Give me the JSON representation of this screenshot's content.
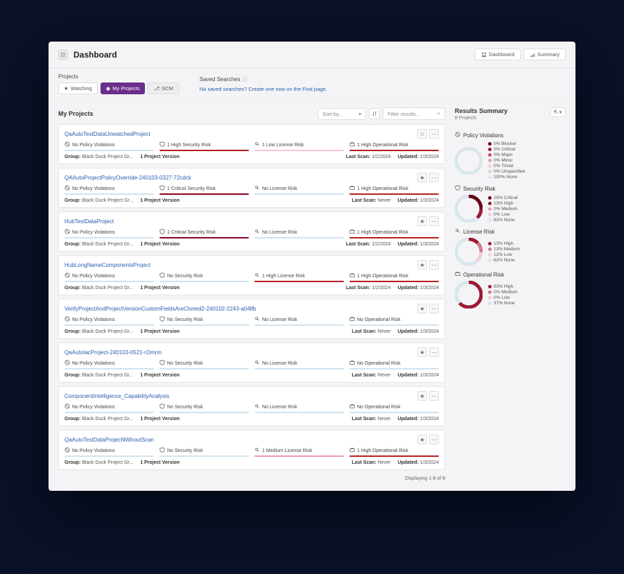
{
  "header": {
    "title": "Dashboard",
    "tab_dashboard": "Dashboard",
    "tab_summary": "Summary"
  },
  "filters": {
    "projects_label": "Projects",
    "watching": "Watching",
    "my_projects": "My Projects",
    "scm": "SCM",
    "saved_label": "Saved Searches",
    "saved_empty": "No saved searches? Create one now on the Find page."
  },
  "list": {
    "heading": "My Projects",
    "sort_placeholder": "Sort by...",
    "filter_placeholder": "Filter results...",
    "footer": "Displaying 1-8 of 8"
  },
  "projects": [
    {
      "name": "QaAutoTestDataUnwatchedProject",
      "policy": "No Policy Violations",
      "policy_bar": "none",
      "security": "1 High Security Risk",
      "security_bar": "high",
      "license": "1 Low License Risk",
      "license_bar": "low",
      "operational": "1 High Operational Risk",
      "operational_bar": "high",
      "group": "Black Duck Project Gr...",
      "versions": "1 Project Version",
      "last_scan": "1/2/2024",
      "updated": "1/3/2024",
      "star": "☆"
    },
    {
      "name": "QAAutoProjectPolicyOverride-240103-0327-72cdck",
      "policy": "No Policy Violations",
      "policy_bar": "none",
      "security": "1 Critical Security Risk",
      "security_bar": "crit",
      "license": "No License Risk",
      "license_bar": "none",
      "operational": "1 High Operational Risk",
      "operational_bar": "high",
      "group": "Black Duck Project Gr...",
      "versions": "1 Project Version",
      "last_scan": "Never",
      "updated": "1/3/2024",
      "star": "★"
    },
    {
      "name": "HubTestDataProject",
      "policy": "No Policy Violations",
      "policy_bar": "none",
      "security": "1 Critical Security Risk",
      "security_bar": "crit",
      "license": "No License Risk",
      "license_bar": "none",
      "operational": "1 High Operational Risk",
      "operational_bar": "high",
      "group": "Black Duck Project Gr...",
      "versions": "1 Project Version",
      "last_scan": "1/2/2024",
      "updated": "1/3/2024",
      "star": "★"
    },
    {
      "name": "HubLongNameComponentsProject",
      "policy": "No Policy Violations",
      "policy_bar": "none",
      "security": "No Security Risk",
      "security_bar": "none",
      "license": "1 High License Risk",
      "license_bar": "high",
      "operational": "1 High Operational Risk",
      "operational_bar": "high",
      "group": "Black Duck Project Gr...",
      "versions": "1 Project Version",
      "last_scan": "1/2/2024",
      "updated": "1/3/2024",
      "star": "★"
    },
    {
      "name": "VerifyProjectAndProjectVersionCustomFieldsAreCloned2-240102-2243-a04lfb",
      "policy": "No Policy Violations",
      "policy_bar": "none",
      "security": "No Security Risk",
      "security_bar": "none",
      "license": "No License Risk",
      "license_bar": "none",
      "operational": "No Operational Risk",
      "operational_bar": "none",
      "group": "Black Duck Project Gr...",
      "versions": "1 Project Version",
      "last_scan": "Never",
      "updated": "1/3/2024",
      "star": "★"
    },
    {
      "name": "QaAutoIacProject-240103-0521-r2imrm",
      "policy": "No Policy Violations",
      "policy_bar": "none",
      "security": "No Security Risk",
      "security_bar": "none",
      "license": "No License Risk",
      "license_bar": "none",
      "operational": "No Operational Risk",
      "operational_bar": "none",
      "group": "Black Duck Project Gr...",
      "versions": "1 Project Version",
      "last_scan": "Never",
      "updated": "1/3/2024",
      "star": "★"
    },
    {
      "name": "ComponentIntelligence_CapabilityAnalysis",
      "policy": "No Policy Violations",
      "policy_bar": "none",
      "security": "No Security Risk",
      "security_bar": "none",
      "license": "No License Risk",
      "license_bar": "none",
      "operational": "No Operational Risk",
      "operational_bar": "none",
      "group": "Black Duck Project Gr...",
      "versions": "1 Project Version",
      "last_scan": "Never",
      "updated": "1/3/2024",
      "star": "★"
    },
    {
      "name": "QaAutoTestDataProjectWithoutScan",
      "policy": "No Policy Violations",
      "policy_bar": "none",
      "security": "No Security Risk",
      "security_bar": "none",
      "license": "1 Medium License Risk",
      "license_bar": "med",
      "operational": "1 High Operational Risk",
      "operational_bar": "high",
      "group": "Black Duck Project Gr...",
      "versions": "1 Project Version",
      "last_scan": "Never",
      "updated": "1/3/2024",
      "star": "★"
    }
  ],
  "summary": {
    "title": "Results Summary",
    "count": "8 Projects",
    "sections": {
      "policy": {
        "title": "Policy Violations",
        "items": [
          {
            "label": "0% Blocker",
            "color": "#6b0014"
          },
          {
            "label": "0% Critical",
            "color": "#9e1b32"
          },
          {
            "label": "0% Major",
            "color": "#c0506a"
          },
          {
            "label": "0% Minor",
            "color": "#e3a5b3"
          },
          {
            "label": "0% Trivial",
            "color": "#efd0d6"
          },
          {
            "label": "0% Unspecified",
            "color": "#d6d6d6"
          },
          {
            "label": "100% None",
            "color": "#d9e6ee"
          }
        ],
        "donut": [
          {
            "c": "#d9e6ee",
            "v": 100
          }
        ]
      },
      "security": {
        "title": "Security Risk",
        "items": [
          {
            "label": "25% Critical",
            "color": "#6b0014"
          },
          {
            "label": "13% High",
            "color": "#9e1b32"
          },
          {
            "label": "0% Medium",
            "color": "#e3a5b3"
          },
          {
            "label": "0% Low",
            "color": "#efd0d6"
          },
          {
            "label": "62% None",
            "color": "#d9e6ee"
          }
        ],
        "donut": [
          {
            "c": "#6b0014",
            "v": 25
          },
          {
            "c": "#9e1b32",
            "v": 13
          },
          {
            "c": "#d9e6ee",
            "v": 62
          }
        ]
      },
      "license": {
        "title": "License Risk",
        "items": [
          {
            "label": "13% High",
            "color": "#9e1b32"
          },
          {
            "label": "13% Medium",
            "color": "#d17a88"
          },
          {
            "label": "12% Low",
            "color": "#efd0d6"
          },
          {
            "label": "62% None",
            "color": "#d9e6ee"
          }
        ],
        "donut": [
          {
            "c": "#9e1b32",
            "v": 13
          },
          {
            "c": "#d17a88",
            "v": 13
          },
          {
            "c": "#efd0d6",
            "v": 12
          },
          {
            "c": "#d9e6ee",
            "v": 62
          }
        ]
      },
      "operational": {
        "title": "Operational Risk",
        "items": [
          {
            "label": "63% High",
            "color": "#9e1b32"
          },
          {
            "label": "0% Medium",
            "color": "#d17a88"
          },
          {
            "label": "0% Low",
            "color": "#efd0d6"
          },
          {
            "label": "37% None",
            "color": "#d9e6ee"
          }
        ],
        "donut": [
          {
            "c": "#9e1b32",
            "v": 63
          },
          {
            "c": "#d9e6ee",
            "v": 37
          }
        ]
      }
    }
  },
  "labels": {
    "group": "Group:",
    "last_scan": "Last Scan:",
    "updated": "Updated:"
  }
}
